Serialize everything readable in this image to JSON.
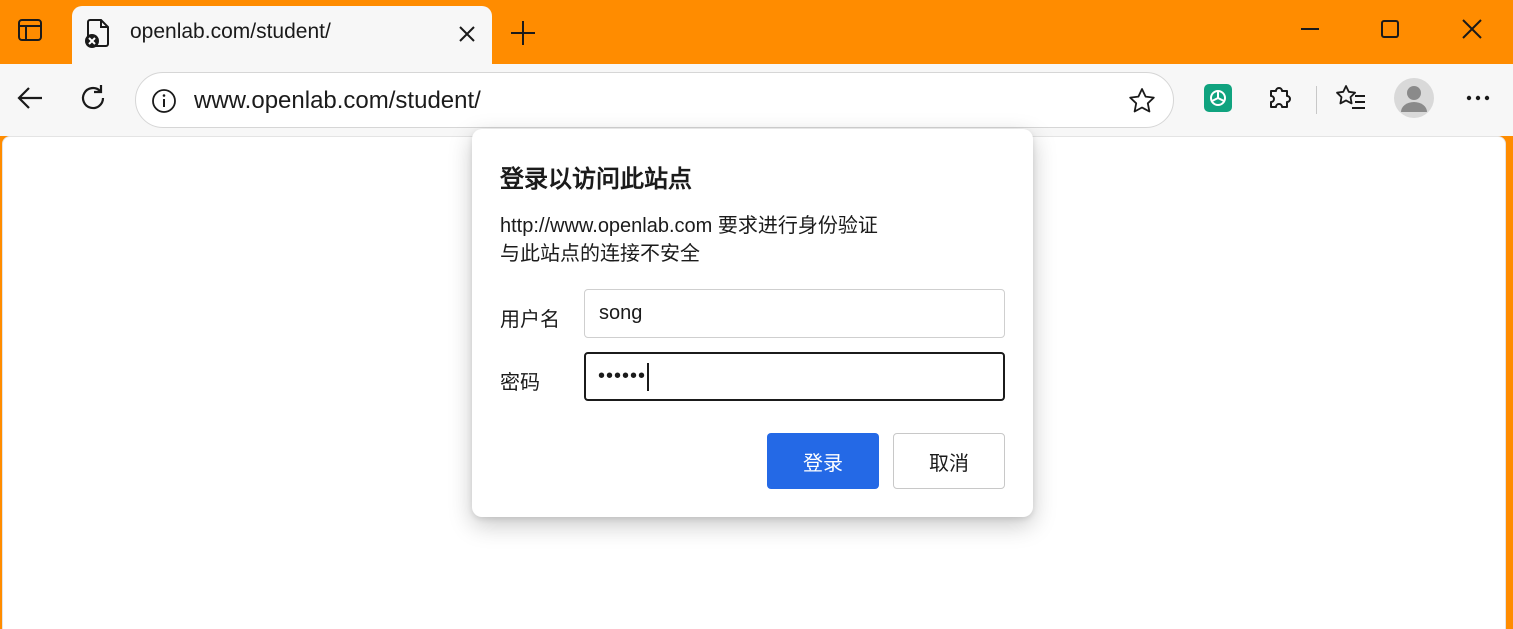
{
  "browser": {
    "tab": {
      "title": "openlab.com/student/"
    },
    "address_bar": {
      "url": "www.openlab.com/student/"
    }
  },
  "auth_dialog": {
    "title": "登录以访问此站点",
    "message_line1": "http://www.openlab.com 要求进行身份验证",
    "message_line2": "与此站点的连接不安全",
    "username_label": "用户名",
    "username_value": "song",
    "password_label": "密码",
    "password_masked": "••••••",
    "login_button": "登录",
    "cancel_button": "取消"
  },
  "colors": {
    "frame": "#ff8c00",
    "toolbar": "#f7f7f7",
    "primary_button": "#2469e6",
    "chatgpt_ext": "#10a37f"
  },
  "icons": [
    "tab-actions-icon",
    "file-error-icon",
    "close-icon",
    "plus-icon",
    "minimize-icon",
    "maximize-icon",
    "window-close-icon",
    "back-arrow-icon",
    "reload-icon",
    "info-icon",
    "star-icon",
    "chatgpt-icon",
    "puzzle-icon",
    "favorites-icon",
    "profile-icon",
    "more-icon"
  ]
}
